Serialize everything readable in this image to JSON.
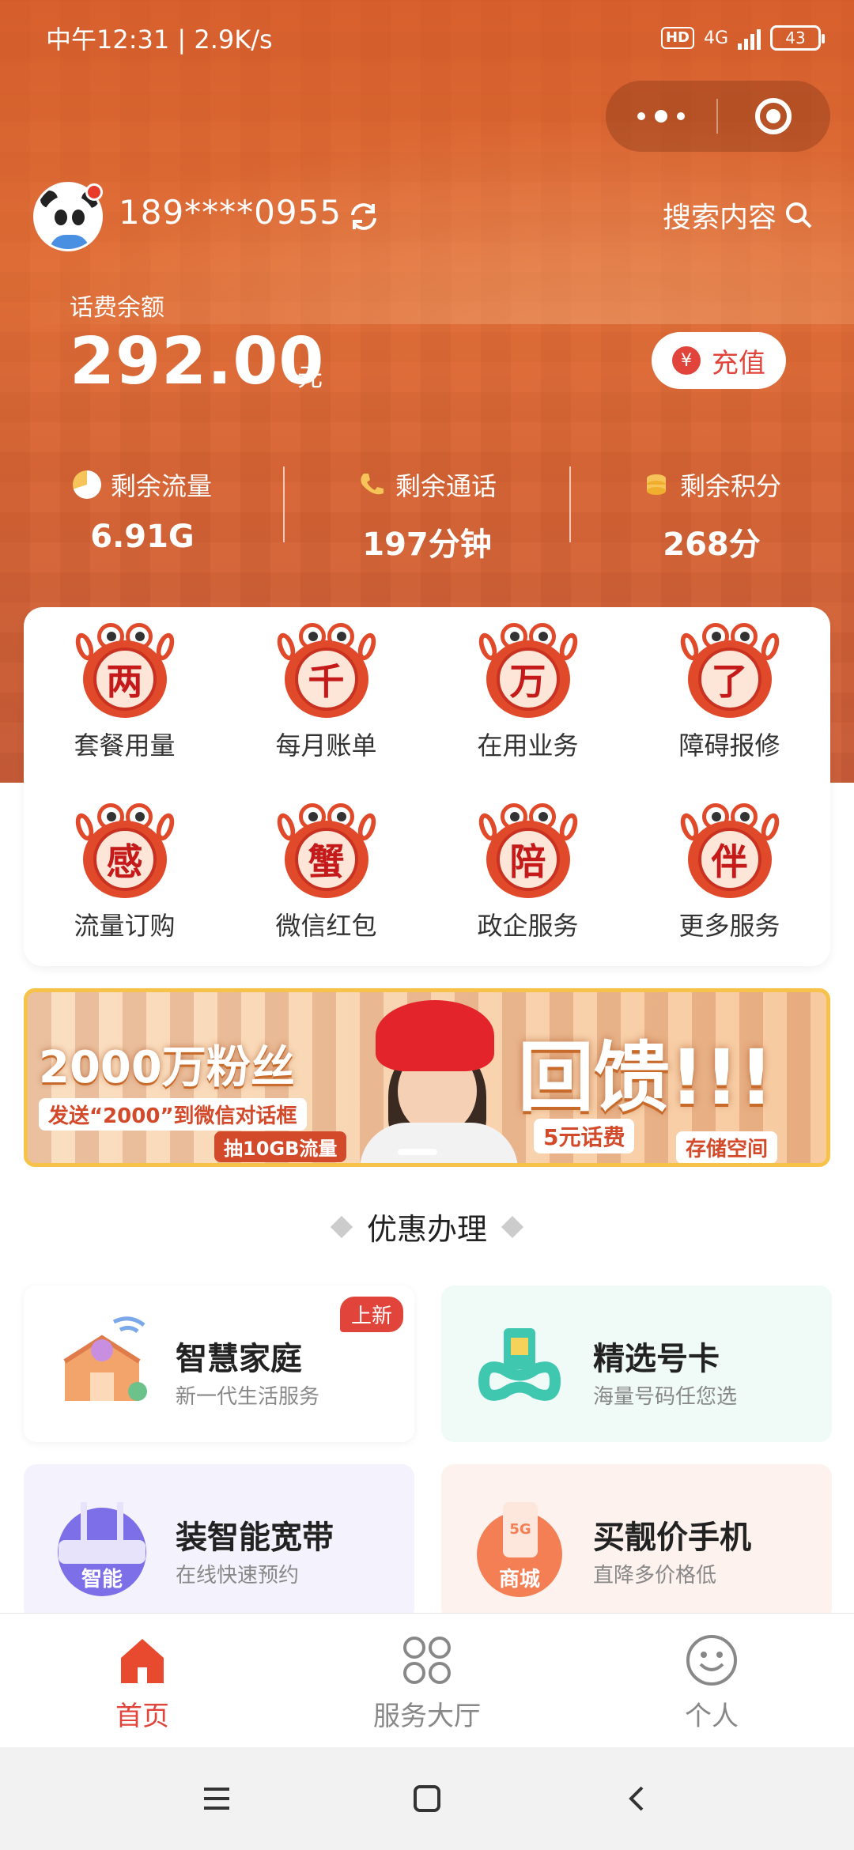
{
  "status_bar": {
    "time": "中午12:31 | 2.9K/s",
    "hd": "HD",
    "network": "4G",
    "battery": "43"
  },
  "user": {
    "phone": "189****0955",
    "search_label": "搜索内容"
  },
  "balance": {
    "label": "话费余额",
    "amount": "292.00",
    "unit": "元",
    "recharge_label": "充值"
  },
  "stats": [
    {
      "label": "剩余流量",
      "value": "6.91G",
      "icon": "pie-icon"
    },
    {
      "label": "剩余通话",
      "value": "197分钟",
      "icon": "phone-icon"
    },
    {
      "label": "剩余积分",
      "value": "268分",
      "icon": "coins-icon"
    }
  ],
  "services": [
    {
      "char": "两",
      "label": "套餐用量"
    },
    {
      "char": "千",
      "label": "每月账单"
    },
    {
      "char": "万",
      "label": "在用业务"
    },
    {
      "char": "了",
      "label": "障碍报修"
    },
    {
      "char": "感",
      "label": "流量订购"
    },
    {
      "char": "蟹",
      "label": "微信红包"
    },
    {
      "char": "陪",
      "label": "政企服务"
    },
    {
      "char": "伴",
      "label": "更多服务"
    }
  ],
  "banner": {
    "headline_left": "2000万粉丝",
    "headline_right": "回馈!!!",
    "tag_send": "发送“2000”到微信对话框",
    "tag_flow": "抽10GB流量",
    "tag_fee": "5元话费",
    "tag_storage": "存储空间"
  },
  "section": {
    "title": "优惠办理"
  },
  "promos": [
    {
      "title": "智慧家庭",
      "sub": "新一代生活服务",
      "badge": "上新",
      "bg": "#ffffff"
    },
    {
      "title": "精选号卡",
      "sub": "海量号码任您选",
      "bg": "#f0fbf8"
    },
    {
      "title": "装智能宽带",
      "sub": "在线快速预约",
      "bg": "#f4f3fd"
    },
    {
      "title": "买靓价手机",
      "sub": "直降多价格低",
      "bg": "#fdf2ee"
    }
  ],
  "bottom_nav": [
    {
      "label": "首页",
      "icon": "home-icon",
      "active": true
    },
    {
      "label": "服务大厅",
      "icon": "grid-icon",
      "active": false
    },
    {
      "label": "个人",
      "icon": "smile-icon",
      "active": false
    }
  ],
  "colors": {
    "brand": "#e0443a",
    "hero": "#d8672f",
    "banner_border": "#f6c24a"
  }
}
